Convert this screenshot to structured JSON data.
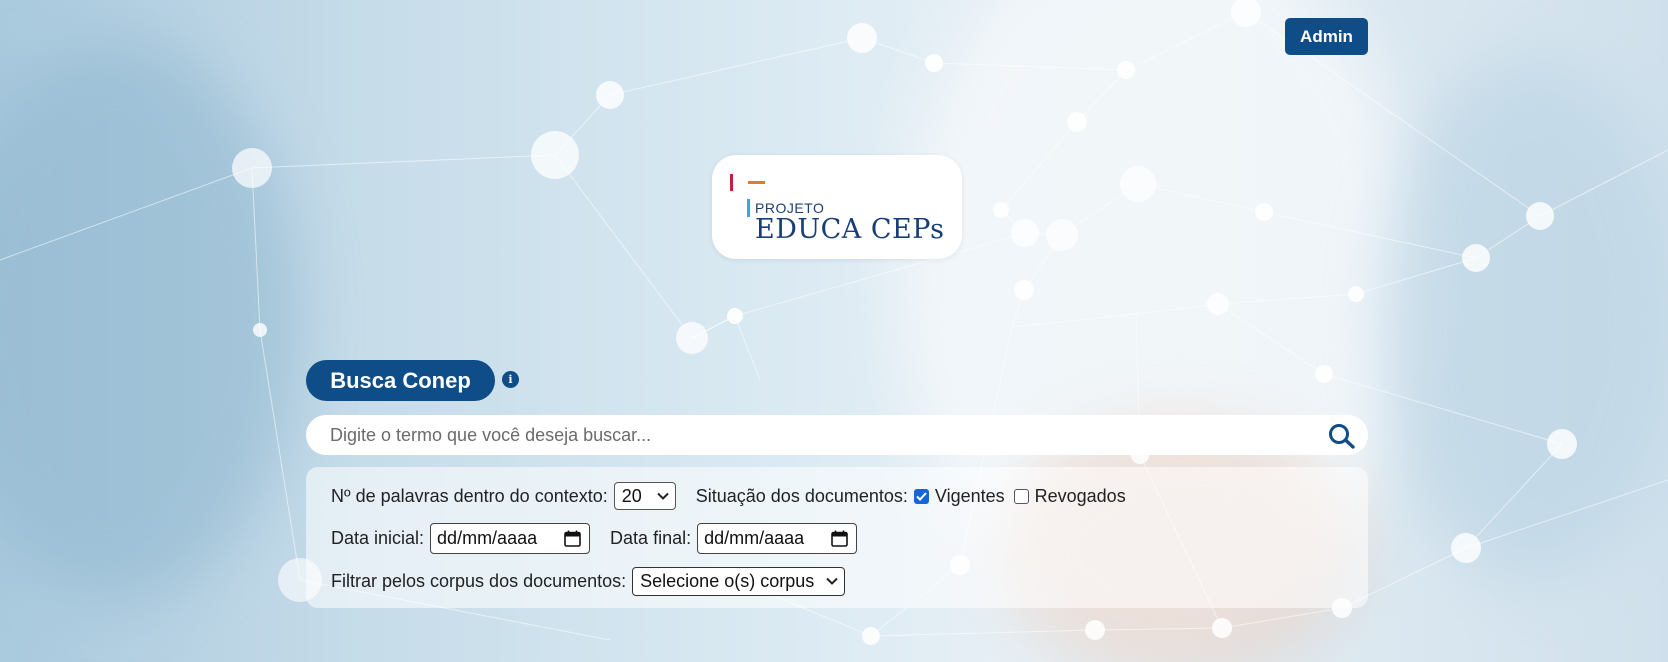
{
  "header": {
    "admin_label": "Admin"
  },
  "logo": {
    "projeto": "PROJETO",
    "name": "EDUCA CEPs"
  },
  "search": {
    "title": "Busca Conep",
    "info_icon": "info-icon",
    "placeholder": "Digite o termo que você deseja buscar...",
    "value": "",
    "icon": "search-icon"
  },
  "filters": {
    "words_label": "Nº de palavras dentro do contexto:",
    "words_value": "20",
    "status_label": "Situação dos documentos:",
    "status_options": [
      {
        "label": "Vigentes",
        "checked": true
      },
      {
        "label": "Revogados",
        "checked": false
      }
    ],
    "start_date_label": "Data inicial:",
    "start_date_value": "dd/mm/aaaa",
    "end_date_label": "Data final:",
    "end_date_value": "dd/mm/aaaa",
    "corpus_label": "Filtrar pelos corpus dos documentos:",
    "corpus_value": "Selecione o(s) corpus"
  },
  "colors": {
    "primary": "#0e4d87",
    "checkbox_accent": "#1565d8",
    "logo_red": "#c4203f",
    "logo_orange": "#e07a2f",
    "logo_blue": "#3ca7da"
  }
}
